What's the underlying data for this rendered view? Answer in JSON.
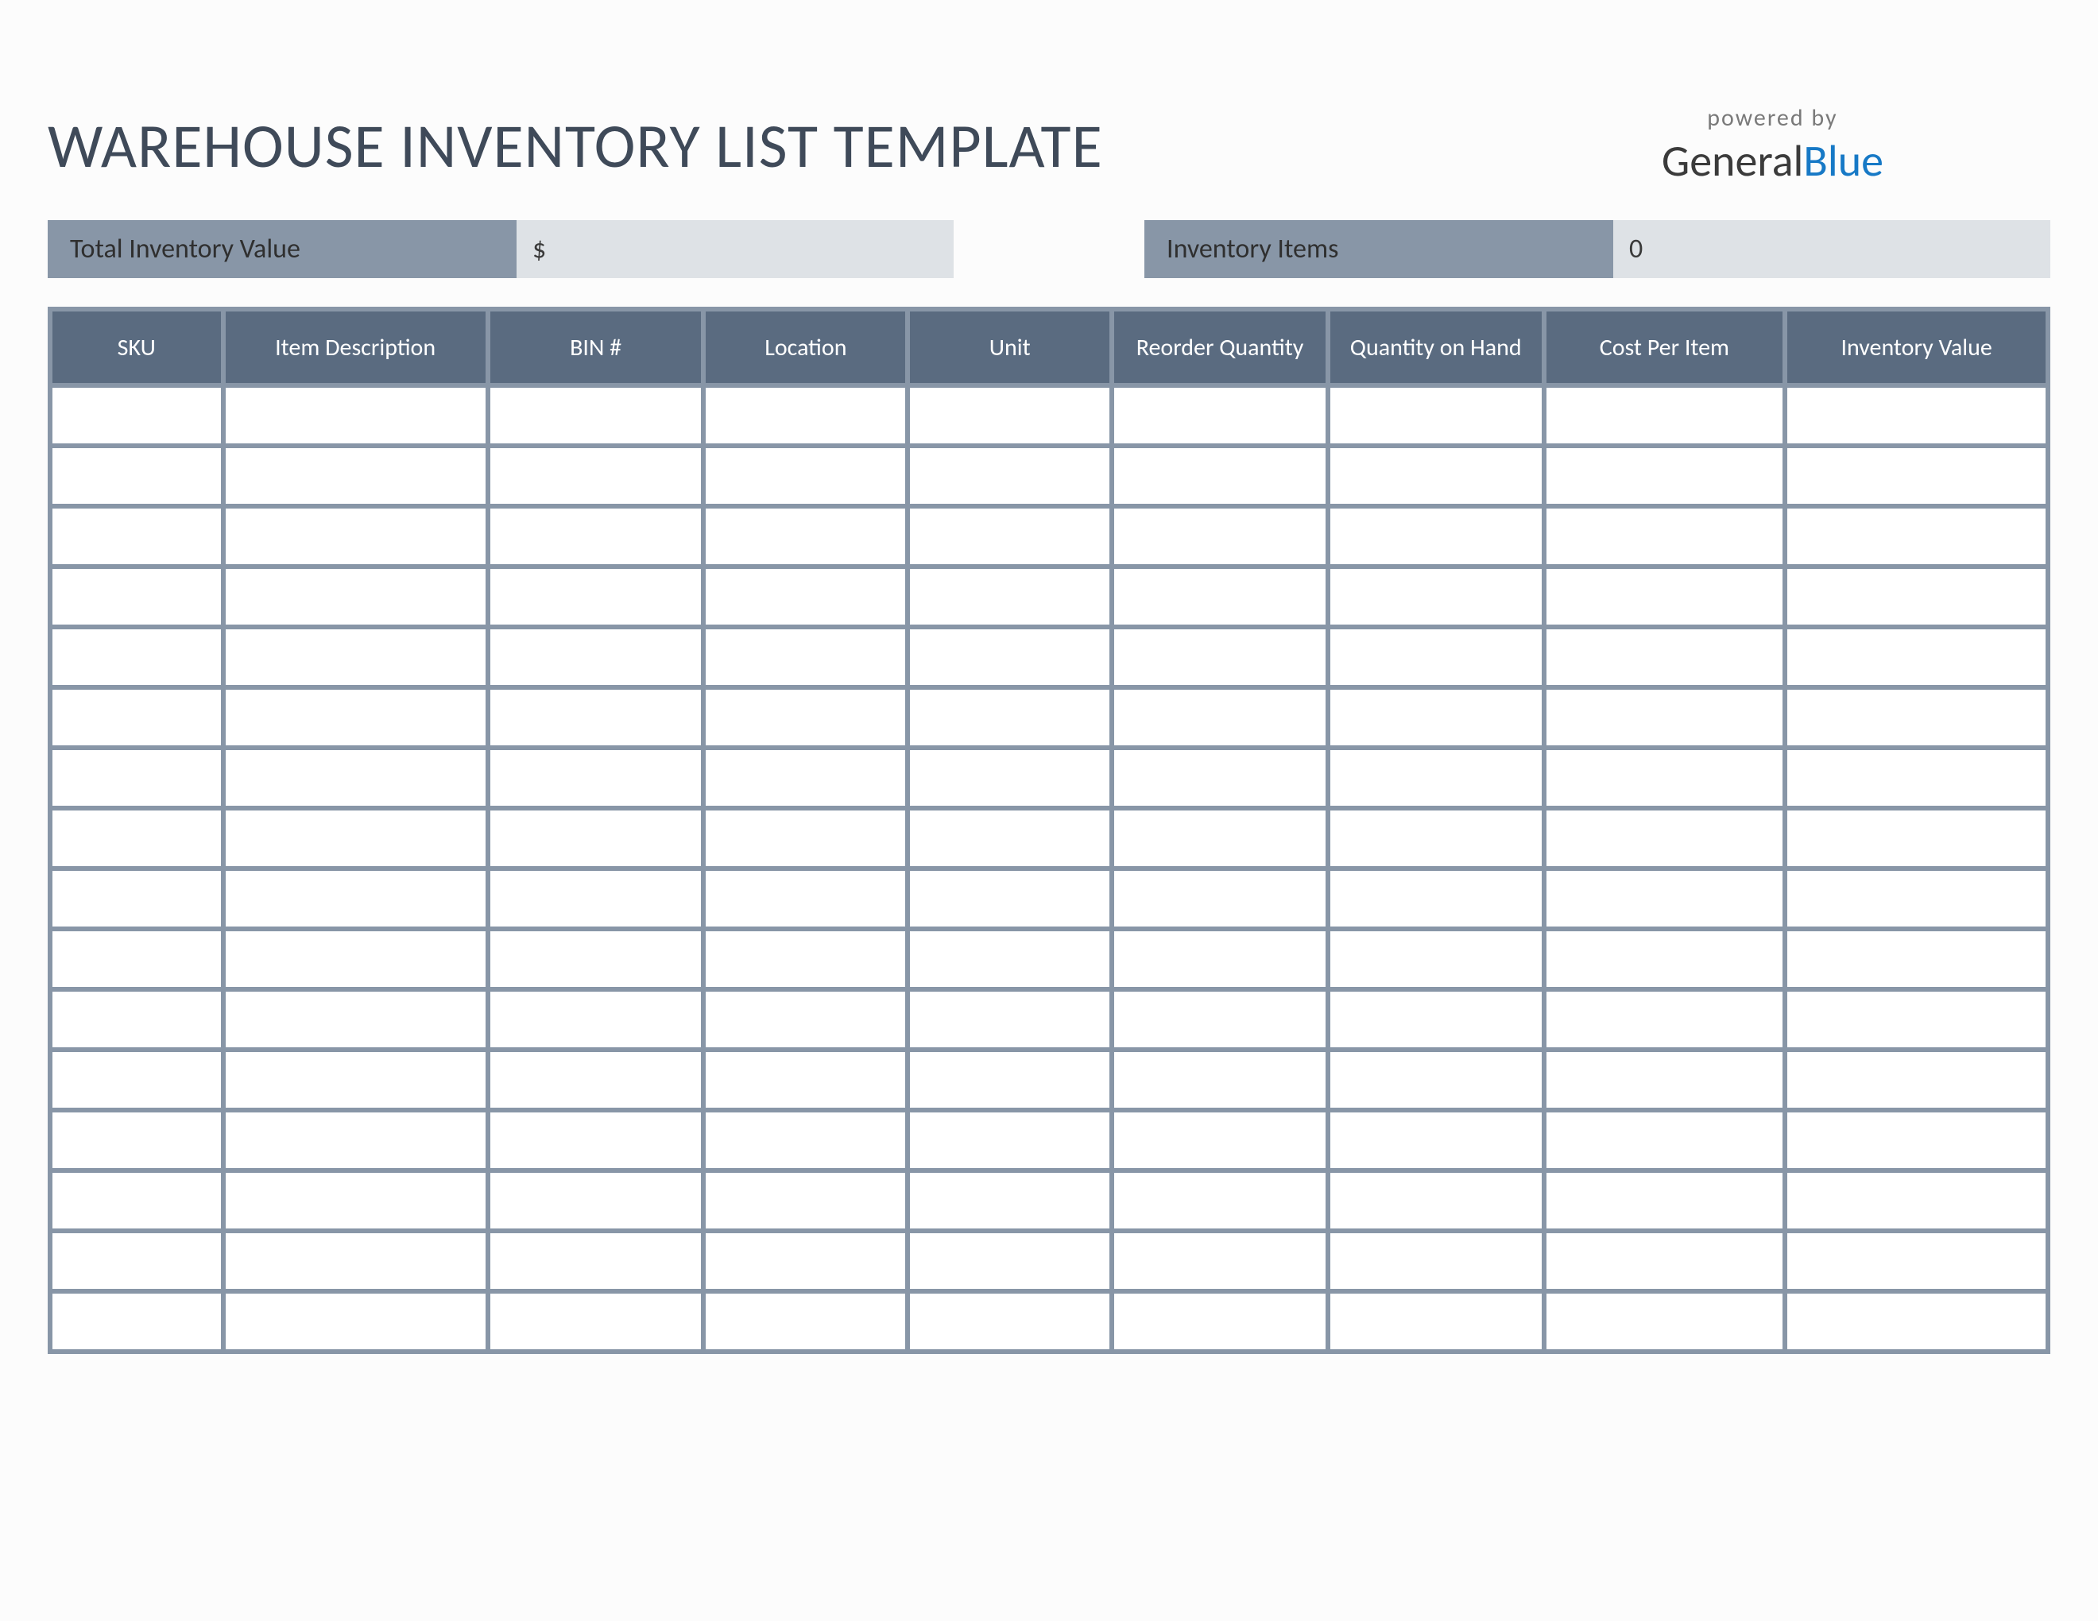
{
  "title": "WAREHOUSE INVENTORY LIST TEMPLATE",
  "logo": {
    "sub": "powered by",
    "main_left": "General",
    "main_right": "Blue"
  },
  "summary": {
    "total_label": "Total Inventory Value",
    "total_value": "$",
    "items_label": "Inventory Items",
    "items_value": "0"
  },
  "columns": [
    "SKU",
    "Item Description",
    "BIN #",
    "Location",
    "Unit",
    "Reorder Quantity",
    "Quantity on Hand",
    "Cost Per Item",
    "Inventory Value"
  ],
  "row_count": 16
}
